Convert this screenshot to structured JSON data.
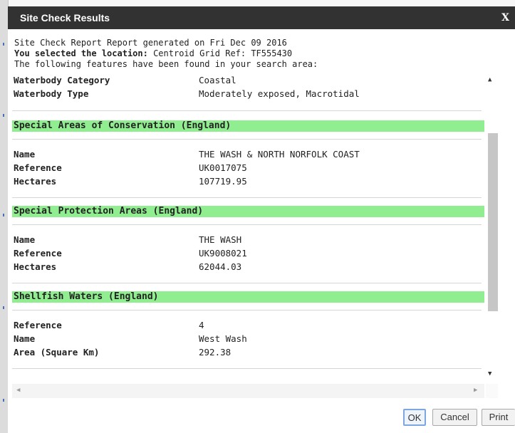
{
  "dialog": {
    "title": "Site Check Results",
    "close_label": "X"
  },
  "intro": {
    "line1": "Site Check Report Report generated on Fri Dec 09 2016",
    "line2_label": "You selected the location:",
    "line2_value": " Centroid Grid Ref: TF555430",
    "line3": "The following features have been found in your search area:"
  },
  "top_rows": [
    {
      "key": "Waterbody Category",
      "value": "Coastal"
    },
    {
      "key": "Waterbody Type",
      "value": "Moderately exposed, Macrotidal"
    }
  ],
  "sections": [
    {
      "title": "Special Areas of Conservation (England)",
      "rows": [
        {
          "key": "Name",
          "value": "THE WASH & NORTH NORFOLK COAST"
        },
        {
          "key": "Reference",
          "value": "UK0017075"
        },
        {
          "key": "Hectares",
          "value": "107719.95"
        }
      ]
    },
    {
      "title": "Special Protection Areas (England)",
      "rows": [
        {
          "key": "Name",
          "value": "THE WASH"
        },
        {
          "key": "Reference",
          "value": "UK9008021"
        },
        {
          "key": "Hectares",
          "value": "62044.03"
        }
      ]
    },
    {
      "title": "Shellfish Waters (England)",
      "rows": [
        {
          "key": "Reference",
          "value": "4"
        },
        {
          "key": "Name",
          "value": "West Wash"
        },
        {
          "key": "Area (Square Km)",
          "value": "292.38"
        }
      ]
    }
  ],
  "buttons": {
    "ok": "OK",
    "cancel": "Cancel",
    "print": "Print"
  }
}
